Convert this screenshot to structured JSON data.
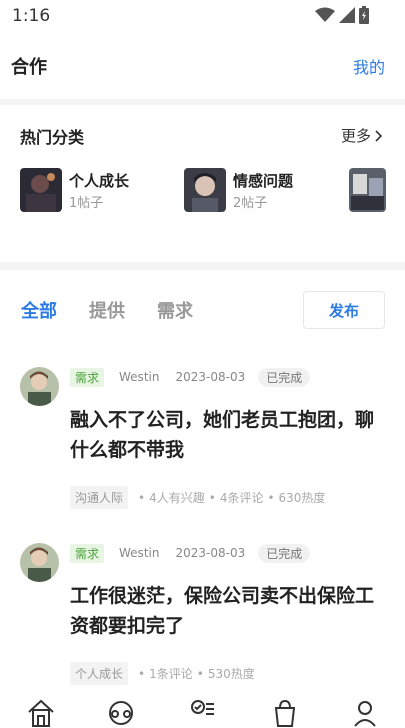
{
  "status_bar": {
    "time": "1:16"
  },
  "header": {
    "title": "合作",
    "mine_label": "我的"
  },
  "hot_section": {
    "title": "热门分类",
    "more_label": "更多",
    "categories": [
      {
        "name": "个人成长",
        "count": "1帖子"
      },
      {
        "name": "情感问题",
        "count": "2帖子"
      }
    ]
  },
  "tabs": [
    {
      "label": "全部"
    },
    {
      "label": "提供"
    },
    {
      "label": "需求"
    }
  ],
  "publish_label": "发布",
  "posts": [
    {
      "type": "需求",
      "author": "Westin",
      "date": "2023-08-03",
      "status": "已完成",
      "title": "融入不了公司，她们老员工抱团，聊什么都不带我",
      "category": "沟通人际",
      "stats": [
        "4人有兴趣",
        "4条评论",
        "630热度"
      ]
    },
    {
      "type": "需求",
      "author": "Westin",
      "date": "2023-08-03",
      "status": "已完成",
      "title": "工作很迷茫，保险公司卖不出保险工资都要扣完了",
      "category": "个人成长",
      "stats": [
        "1条评论",
        "530热度"
      ]
    }
  ],
  "bottom_nav": [
    {
      "icon": "home-icon"
    },
    {
      "icon": "community-icon"
    },
    {
      "icon": "cooperation-icon"
    },
    {
      "icon": "shop-icon"
    },
    {
      "icon": "profile-icon"
    }
  ],
  "colors": {
    "accent": "#2c7be5",
    "tag_green": "#4ba43a"
  }
}
